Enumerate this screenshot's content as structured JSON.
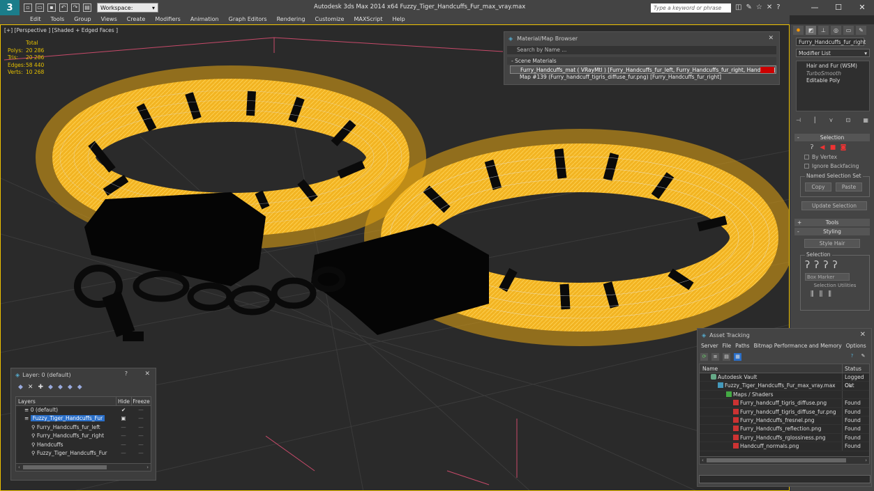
{
  "titlebar": {
    "workspace": "Workspace: Default",
    "title": "Autodesk 3ds Max  2014 x64      Fuzzy_Tiger_Handcuffs_Fur_max_vray.max",
    "search_placeholder": "Type a keyword or phrase"
  },
  "menu": [
    "Edit",
    "Tools",
    "Group",
    "Views",
    "Create",
    "Modifiers",
    "Animation",
    "Graph Editors",
    "Rendering",
    "Customize",
    "MAXScript",
    "Help"
  ],
  "viewport": {
    "label": "[+] [Perspective ] [Shaded + Edged Faces ]",
    "stats_total": "Total",
    "stats": [
      {
        "k": "Polys:",
        "v": "20 286"
      },
      {
        "k": "Tris:",
        "v": "20 286"
      },
      {
        "k": "Edges:",
        "v": "58 440"
      },
      {
        "k": "Verts:",
        "v": "10 268"
      }
    ]
  },
  "material_browser": {
    "title": "Material/Map Browser",
    "search_placeholder": "Search by Name ...",
    "section": "- Scene Materials",
    "item1": "Furry_Handcuffs_mat  ( VRayMtl ) [Furry_Handcuffs_fur_left, Furry_Handcuffs_fur_right, Handcuffs]",
    "item2": "Map #139 (Furry_handcuff_tigris_diffuse_fur.png) [Furry_Handcuffs_fur_right]"
  },
  "command_panel": {
    "object_name": "Furry_Handcuffs_fur_right",
    "modifier_list": "Modifier List",
    "stack": [
      "Hair and Fur (WSM)",
      "TurboSmooth",
      "Editable Poly"
    ],
    "selection_rollout": "Selection",
    "by_vertex": "By Vertex",
    "ignore_backfacing": "Ignore Backfacing",
    "named_selection_set": "Named Selection Set",
    "copy": "Copy",
    "paste": "Paste",
    "update_selection": "Update Selection",
    "tools_rollout": "Tools",
    "styling_rollout": "Styling",
    "style_hair": "Style Hair",
    "selection_label": "Selection",
    "box_marker": "Box Marker",
    "selection_utilities": "Selection Utilities"
  },
  "layer_explorer": {
    "title": "Layer: 0 (default)",
    "help": "?",
    "columns": [
      "Layers",
      "Hide",
      "Freeze"
    ],
    "rows": [
      {
        "name": "0 (default)",
        "indent": 0,
        "selected": false,
        "check": "✔"
      },
      {
        "name": "Fuzzy_Tiger_Handcuffs_Fur",
        "indent": 0,
        "selected": true,
        "check": "▣"
      },
      {
        "name": "Furry_Handcuffs_fur_left",
        "indent": 1,
        "selected": false,
        "check": ""
      },
      {
        "name": "Furry_Handcuffs_fur_right",
        "indent": 1,
        "selected": false,
        "check": ""
      },
      {
        "name": "Handcuffs",
        "indent": 1,
        "selected": false,
        "check": ""
      },
      {
        "name": "Fuzzy_Tiger_Handcuffs_Fur",
        "indent": 1,
        "selected": false,
        "check": ""
      }
    ]
  },
  "asset_tracking": {
    "title": "Asset Tracking",
    "menu": [
      "Server",
      "File",
      "Paths",
      "Bitmap Performance and Memory",
      "Options"
    ],
    "columns": [
      "Name",
      "Status"
    ],
    "rows": [
      {
        "name": "Autodesk Vault",
        "status": "Logged Out",
        "type": "vault",
        "indent": 1
      },
      {
        "name": "Fuzzy_Tiger_Handcuffs_Fur_max_vray.max",
        "status": "Ok",
        "type": "max",
        "indent": 2
      },
      {
        "name": "Maps / Shaders",
        "status": "",
        "type": "maps",
        "indent": 3
      },
      {
        "name": "Furry_handcuff_tigris_diffuse.png",
        "status": "Found",
        "type": "png",
        "indent": 4
      },
      {
        "name": "Furry_handcuff_tigris_diffuse_fur.png",
        "status": "Found",
        "type": "png",
        "indent": 4
      },
      {
        "name": "Furry_Handcuffs_fresnel.png",
        "status": "Found",
        "type": "png",
        "indent": 4
      },
      {
        "name": "Furry_Handcuffs_reflection.png",
        "status": "Found",
        "type": "png",
        "indent": 4
      },
      {
        "name": "Furry_Handcuffs_rglossiness.png",
        "status": "Found",
        "type": "png",
        "indent": 4
      },
      {
        "name": "Handcuff_normals.png",
        "status": "Found",
        "type": "png",
        "indent": 4
      }
    ]
  },
  "colors": {
    "fur": "#f2b422",
    "stripe": "#0a0a0a",
    "grid": "#3a3a3a",
    "selection_blue": "#2a6fc9",
    "viewport_border": "#f0c300"
  }
}
